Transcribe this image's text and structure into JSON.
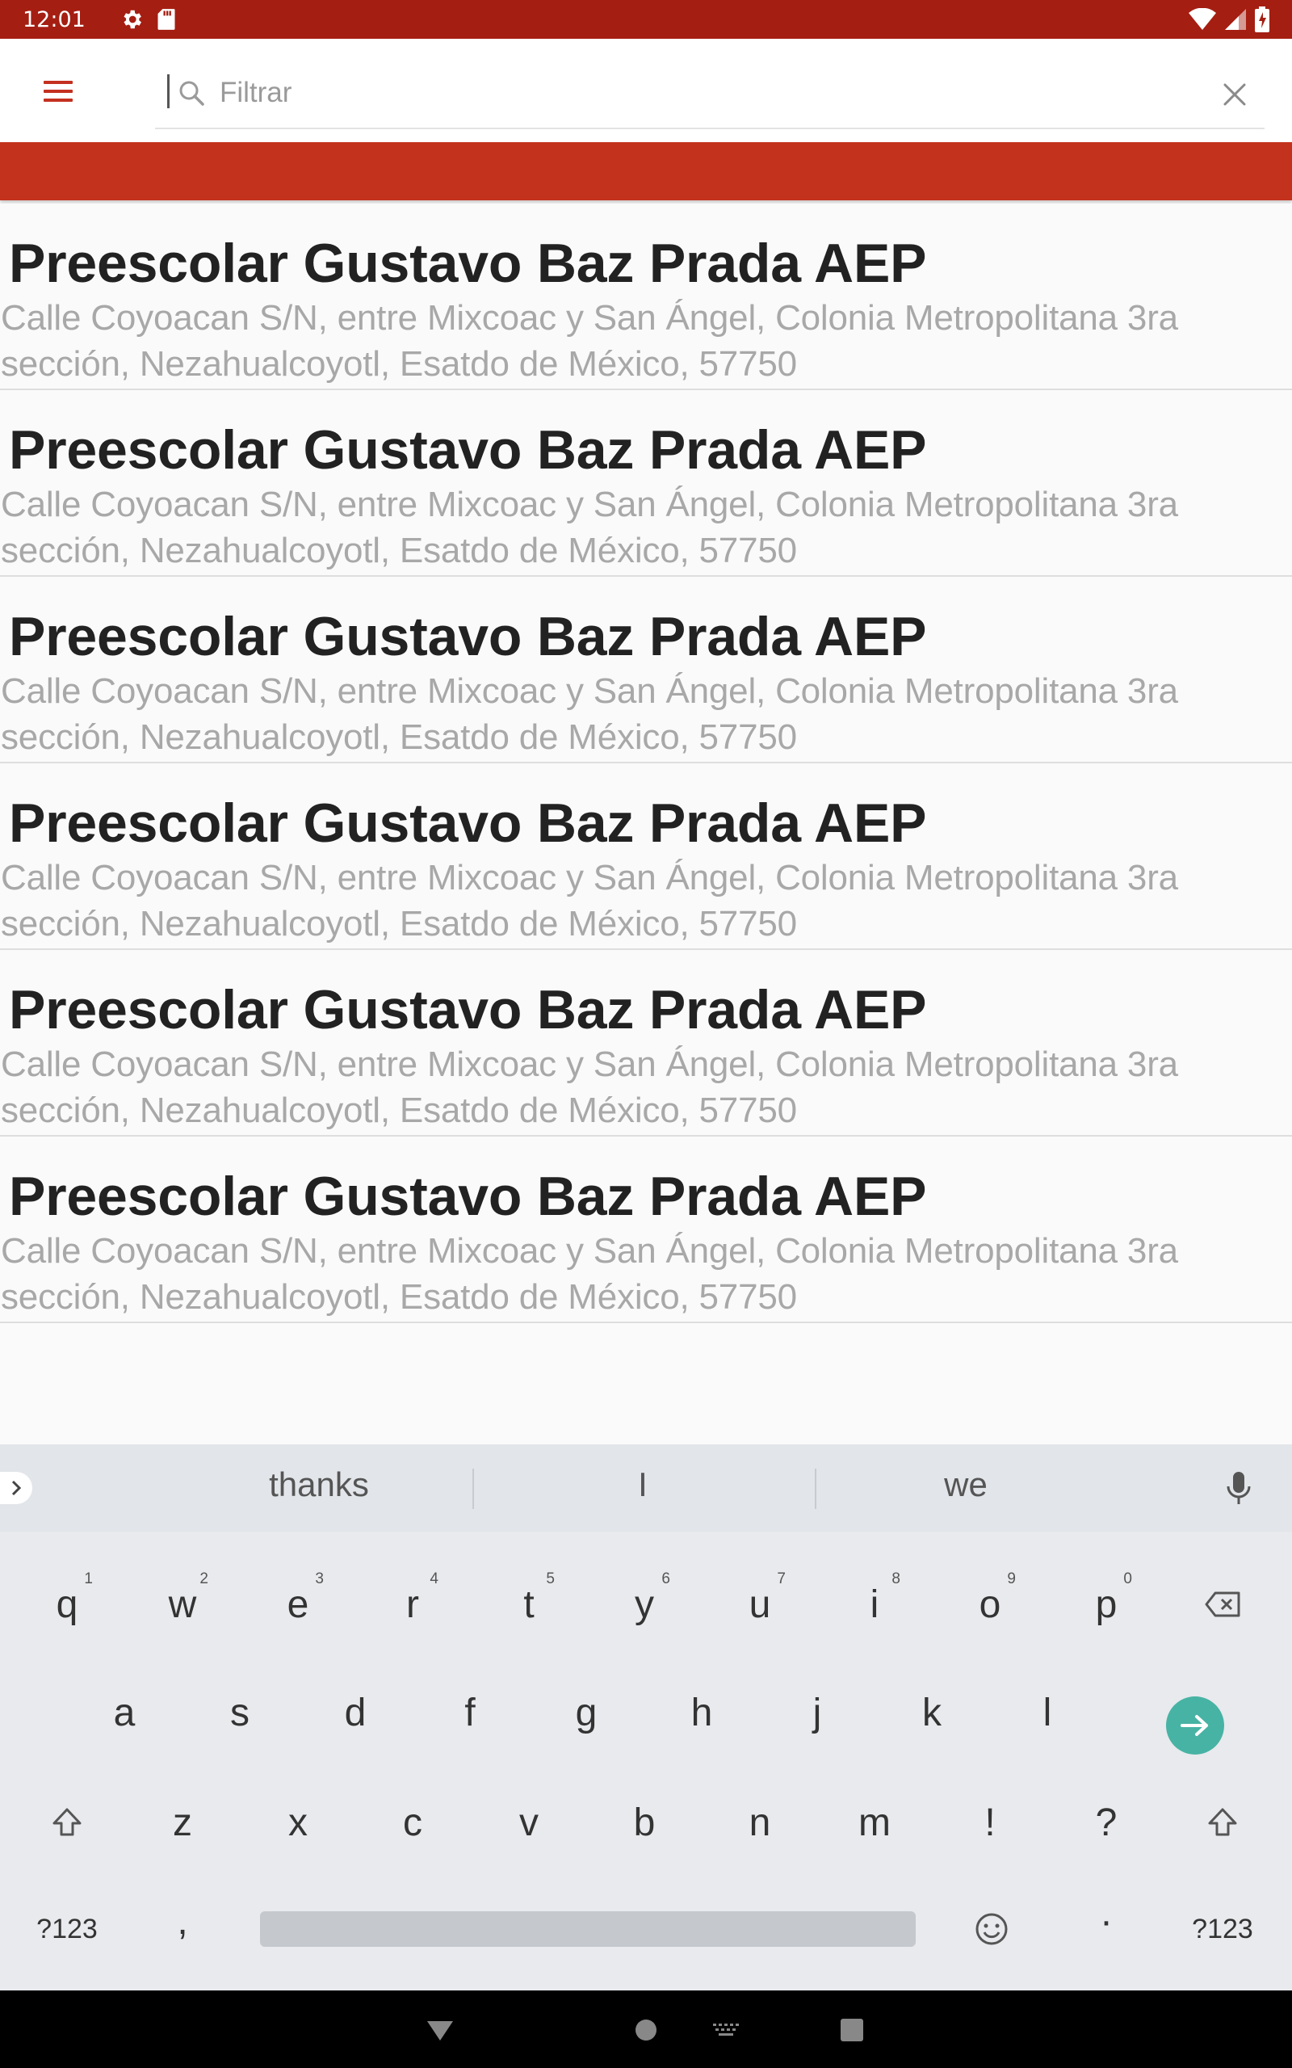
{
  "status_bar": {
    "time": "12:01",
    "background_color": "#a51e12",
    "left_icons": [
      "settings-icon",
      "sd-card-icon"
    ],
    "right_icons": [
      "wifi-icon",
      "signal-icon",
      "battery-icon"
    ]
  },
  "app_bar": {
    "menu_icon": "hamburger-menu-icon",
    "search": {
      "placeholder": "Filtrar",
      "value": ""
    },
    "clear_icon": "close-icon",
    "accent_color": "#c3321c"
  },
  "results": [
    {
      "title": "Preescolar Gustavo Baz Prada AEP",
      "address": "Calle Coyoacan S/N, entre Mixcoac y San Ángel, Colonia Metropolitana 3ra sección, Nezahualcoyotl, Esatdo de México, 57750"
    },
    {
      "title": "Preescolar Gustavo Baz Prada AEP",
      "address": "Calle Coyoacan S/N, entre Mixcoac y San Ángel, Colonia Metropolitana 3ra sección, Nezahualcoyotl, Esatdo de México, 57750"
    },
    {
      "title": "Preescolar Gustavo Baz Prada AEP",
      "address": "Calle Coyoacan S/N, entre Mixcoac y San Ángel, Colonia Metropolitana 3ra sección, Nezahualcoyotl, Esatdo de México, 57750"
    },
    {
      "title": "Preescolar Gustavo Baz Prada AEP",
      "address": "Calle Coyoacan S/N, entre Mixcoac y San Ángel, Colonia Metropolitana 3ra sección, Nezahualcoyotl, Esatdo de México, 57750"
    },
    {
      "title": "Preescolar Gustavo Baz Prada AEP",
      "address": "Calle Coyoacan S/N, entre Mixcoac y San Ángel, Colonia Metropolitana 3ra sección, Nezahualcoyotl, Esatdo de México, 57750"
    },
    {
      "title": "Preescolar Gustavo Baz Prada AEP",
      "address": "Calle Coyoacan S/N, entre Mixcoac y San Ángel, Colonia Metropolitana 3ra sección, Nezahualcoyotl, Esatdo de México, 57750"
    }
  ],
  "keyboard": {
    "suggestions": [
      "thanks",
      "I",
      "we"
    ],
    "row1": [
      "q",
      "w",
      "e",
      "r",
      "t",
      "y",
      "u",
      "i",
      "o",
      "p"
    ],
    "row1_hints": [
      "1",
      "2",
      "3",
      "4",
      "5",
      "6",
      "7",
      "8",
      "9",
      "0"
    ],
    "row2": [
      "a",
      "s",
      "d",
      "f",
      "g",
      "h",
      "j",
      "k",
      "l"
    ],
    "row3": [
      "z",
      "x",
      "c",
      "v",
      "b",
      "n",
      "m",
      "!",
      "?"
    ],
    "symbols_label": "?123",
    "comma": ",",
    "period": "·",
    "enter_color": "#47b3a4",
    "icons": [
      "expand-suggestions-icon",
      "microphone-icon",
      "backspace-icon",
      "enter-arrow-icon",
      "shift-icon",
      "emoji-icon"
    ]
  },
  "nav_bar": {
    "icons": [
      "back-icon",
      "home-icon",
      "keyboard-switch-icon",
      "recents-icon"
    ]
  }
}
